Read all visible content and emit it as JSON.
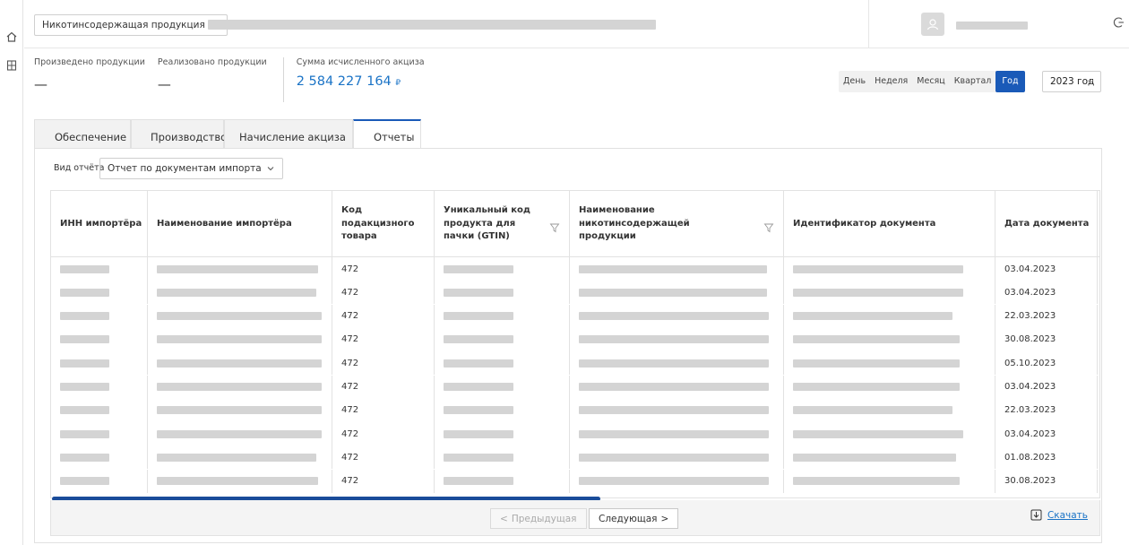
{
  "header": {
    "product_select": "Никотинсодержащая продукция"
  },
  "stats": {
    "produced_label": "Произведено продукции",
    "produced_value": "—",
    "sold_label": "Реализовано продукции",
    "sold_value": "—",
    "excise_label": "Сумма исчисленного акциза",
    "excise_value": "2 584 227 164",
    "currency": "₽"
  },
  "period": {
    "options": [
      "День",
      "Неделя",
      "Месяц",
      "Квартал",
      "Год"
    ],
    "active": "Год",
    "year": "2023 год"
  },
  "tabs": [
    "Обеспечение",
    "Производство",
    "Начисление акциза",
    "Отчеты"
  ],
  "active_tab": "Отчеты",
  "report": {
    "type_label": "Вид отчёта",
    "type_value": "Отчет по документам импорта"
  },
  "table": {
    "columns": [
      "ИНН импортёра",
      "Наименование импортёра",
      "Код подакцизного товара",
      "Уникальный код продукта для пачки (GTIN)",
      "Наименование никотинсодержащей продукции",
      "Идентификатор документа",
      "Дата документа"
    ],
    "rows": [
      {
        "code": "472",
        "date": "03.04.2023"
      },
      {
        "code": "472",
        "date": "03.04.2023"
      },
      {
        "code": "472",
        "date": "22.03.2023"
      },
      {
        "code": "472",
        "date": "30.08.2023"
      },
      {
        "code": "472",
        "date": "05.10.2023"
      },
      {
        "code": "472",
        "date": "03.04.2023"
      },
      {
        "code": "472",
        "date": "22.03.2023"
      },
      {
        "code": "472",
        "date": "03.04.2023"
      },
      {
        "code": "472",
        "date": "01.08.2023"
      },
      {
        "code": "472",
        "date": "30.08.2023"
      }
    ]
  },
  "pagination": {
    "prev": "Предыдущая",
    "next": "Следующая"
  },
  "download_label": "Скачать",
  "colors": {
    "accent": "#1a5ab8",
    "link": "#1a73c6",
    "scrollbar": "#1a4c9a"
  }
}
